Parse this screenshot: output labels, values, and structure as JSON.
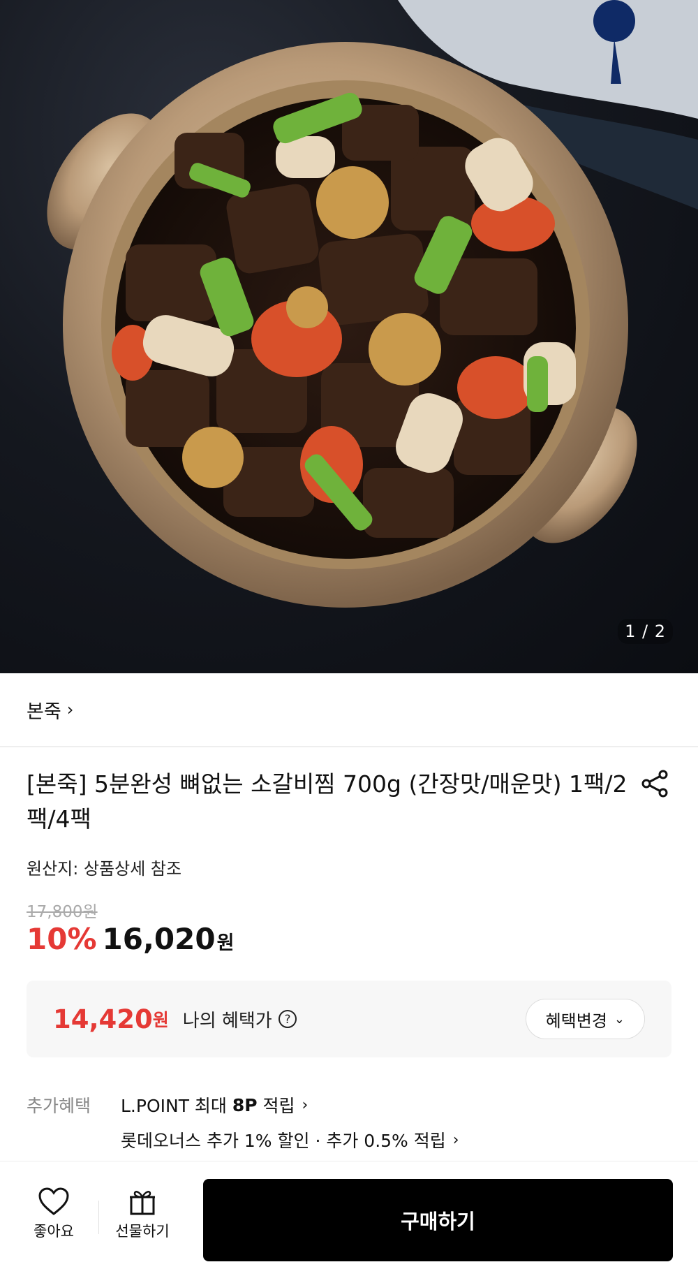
{
  "gallery": {
    "counter": "1 / 2"
  },
  "brand": {
    "label": "본죽"
  },
  "product": {
    "title": "[본죽] 5분완성 뼈없는 소갈비찜 700g (간장맛/매운맛) 1팩/2팩/4팩",
    "origin": "원산지: 상품상세 참조",
    "original_price": "17,800원",
    "discount_rate": "10%",
    "sale_price": "16,020",
    "currency": "원"
  },
  "benefit": {
    "price": "14,420",
    "currency": "원",
    "label": "나의 혜택가",
    "change_label": "혜택변경"
  },
  "extra": {
    "label": "추가혜택",
    "lpoint_prefix": "L.POINT 최대 ",
    "lpoint_points": "8P",
    "lpoint_suffix": " 적립",
    "lotte_card": "롯데오너스 추가 1% 할인 · 추가 0.5% 적립"
  },
  "bottom_bar": {
    "like_label": "좋아요",
    "gift_label": "선물하기",
    "buy_label": "구매하기"
  },
  "colors": {
    "accent": "#e53935",
    "buy_button": "#000000"
  }
}
